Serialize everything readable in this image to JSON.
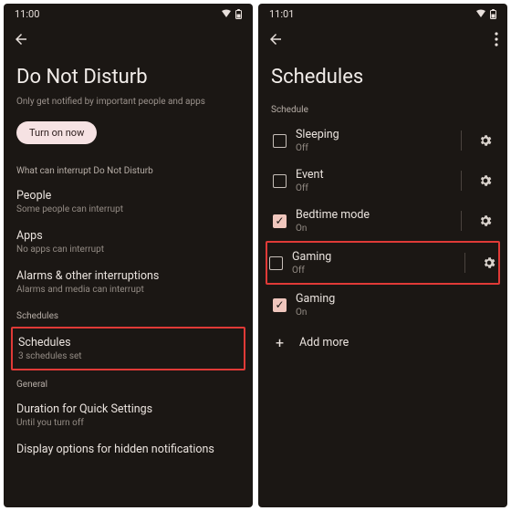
{
  "left": {
    "status": {
      "time": "11:00"
    },
    "title": "Do Not Disturb",
    "subtitle": "Only get notified by important people and apps",
    "turn_on": "Turn on now",
    "section_interrupt": "What can interrupt Do Not Disturb",
    "people": {
      "title": "People",
      "sub": "Some people can interrupt"
    },
    "apps": {
      "title": "Apps",
      "sub": "No apps can interrupt"
    },
    "alarms": {
      "title": "Alarms & other interruptions",
      "sub": "Alarms and media can interrupt"
    },
    "section_schedules": "Schedules",
    "schedules": {
      "title": "Schedules",
      "sub": "3 schedules set"
    },
    "section_general": "General",
    "duration": {
      "title": "Duration for Quick Settings",
      "sub": "Until you turn off"
    },
    "display_opts": {
      "title": "Display options for hidden notifications"
    }
  },
  "right": {
    "status": {
      "time": "11:01"
    },
    "title": "Schedules",
    "section": "Schedule",
    "items": [
      {
        "label": "Sleeping",
        "state": "Off",
        "checked": false,
        "gear": true
      },
      {
        "label": "Event",
        "state": "Off",
        "checked": false,
        "gear": true
      },
      {
        "label": "Bedtime mode",
        "state": "On",
        "checked": true,
        "gear": true
      },
      {
        "label": "Gaming",
        "state": "Off",
        "checked": false,
        "gear": true
      },
      {
        "label": "Gaming",
        "state": "On",
        "checked": true,
        "gear": false
      }
    ],
    "add": "Add more"
  }
}
